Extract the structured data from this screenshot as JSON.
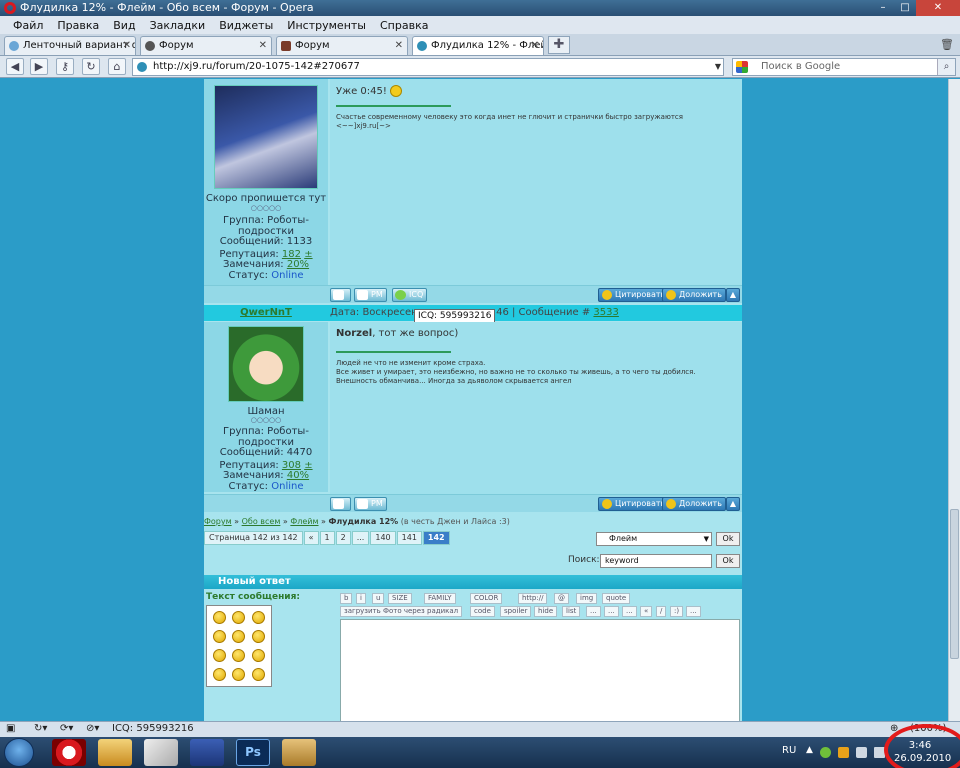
{
  "window": {
    "title": "Флудилка 12% - Флейм - Обо всем - Форум - Opera"
  },
  "menu": [
    "Файл",
    "Правка",
    "Вид",
    "Закладки",
    "Виджеты",
    "Инструменты",
    "Справка"
  ],
  "tabs": [
    {
      "label": "Ленточный вариант ф..."
    },
    {
      "label": "Форум"
    },
    {
      "label": "Форум"
    },
    {
      "label": "Флудилка 12% - Флей..."
    }
  ],
  "address": {
    "url": "http://xj9.ru/forum/20-1075-142#270677"
  },
  "search": {
    "placeholder": "Поиск в Google"
  },
  "post1": {
    "message": "Уже 0:45!",
    "user_title": "Скоро пропишется тут",
    "group": "Группа: Роботы-подростки",
    "messages": "Сообщений: 1133",
    "rep_label": "Репутация:",
    "rep_value": "182",
    "warn_label": "Замечания:",
    "warn_value": "20%",
    "status_label": "Статус:",
    "status_value": "Online",
    "signature": "Счастье современному человеку это когда инет не глючит и странички быстро загружаются",
    "sig_link": "<~~]xj9.ru[~>"
  },
  "post2": {
    "username": "QwerNnT",
    "date_label": "Дата: Воскресенье",
    "date_tail": "46 | Сообщение #",
    "msg_num": "3533",
    "tooltip": "ICQ: 595993216",
    "author": "Norzel",
    "message": ", тот же вопрос)",
    "user_title": "Шаман",
    "group": "Группа: Роботы-подростки",
    "messages": "Сообщений: 4470",
    "rep_label": "Репутация:",
    "rep_value": "308",
    "warn_label": "Замечания:",
    "warn_value": "40%",
    "status_label": "Статус:",
    "status_value": "Online",
    "sig1": "Людей не что не изменит кроме страха.",
    "sig2": "Все живет и умирает, это неизбежно, но важно не то сколько ты живешь, а то чего ты добился.",
    "sig3": "Внешность обманчива... Иногда за дьяволом скрывается ангел"
  },
  "buttons": {
    "pm": "PM",
    "icq": "ICQ",
    "quote": "Цитировать",
    "report": "Доложить"
  },
  "breadcrumb": {
    "forum": "Форум",
    "sep": " » ",
    "cat": "Обо всем",
    "sub": "Флейм",
    "topic": "Флудилка 12%",
    "note": "(в честь Джен и Лайса :3)"
  },
  "pager": {
    "info": "Страница 142 из 142",
    "items": [
      "«",
      "1",
      "2",
      "...",
      "140",
      "141"
    ],
    "current": "142"
  },
  "jump": {
    "value": "Флейм",
    "ok": "Ok"
  },
  "forum_search": {
    "label": "Поиск:",
    "value": "keyword",
    "ok": "Ok"
  },
  "reply": {
    "title": "Новый ответ",
    "label": "Текст сообщения:",
    "toolbar1": [
      "b",
      "i",
      "u",
      "SIZE",
      "FAMILY",
      "COLOR",
      "http://",
      "@",
      "img",
      "quote"
    ],
    "toolbar2": [
      "загрузить Фото через радикал",
      "code",
      "spoiler",
      "hide",
      "list",
      "...",
      "...",
      "...",
      "«",
      "/",
      ":)",
      "..."
    ]
  },
  "status": {
    "icq": "ICQ: 595993216",
    "zoom": "(100%)"
  },
  "taskbar": {
    "lang": "RU",
    "time": "3:46",
    "date": "26.09.2010"
  },
  "colors": {
    "accent": "#2b9cc8",
    "link": "#2d7a2d",
    "online": "#1a57c9",
    "highlight": "#e31b1b"
  }
}
